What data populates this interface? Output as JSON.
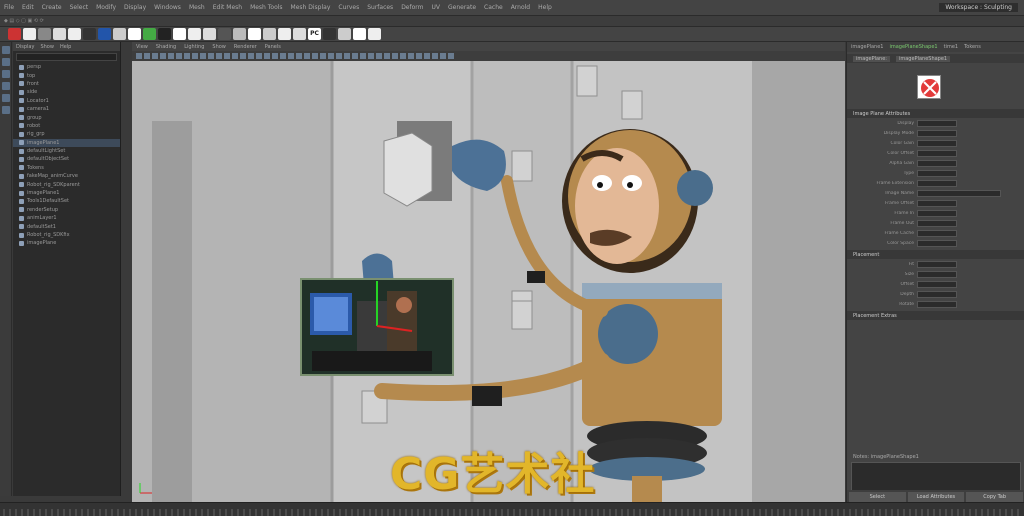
{
  "app": {
    "menu_items": [
      "File",
      "Edit",
      "Create",
      "Select",
      "Modify",
      "Display",
      "Windows",
      "Mesh",
      "Edit Mesh",
      "Mesh Tools",
      "Mesh Display",
      "Curves",
      "Surfaces",
      "Deform",
      "UV",
      "Generate",
      "Cache",
      "Arnold",
      "Help"
    ],
    "workspace_label": "Workspace :",
    "workspace_value": "Sculpting"
  },
  "shelf": {
    "pc_label": "PC"
  },
  "outliner": {
    "menu": [
      "Display",
      "Show",
      "Help"
    ],
    "items": [
      "persp",
      "top",
      "front",
      "side",
      "Locator1",
      "camera1",
      "group",
      "robot",
      "rig_grp",
      "imagePlane1",
      "defaultLightSet",
      "defaultObjectSet",
      "Tokens",
      "fakeMap_animCurve",
      "Robot_rig_SDKparent",
      "imagePlane1",
      "Tools1DefaultSet",
      "renderSetup",
      "animLayer1",
      "defaultSet1",
      "Robot_rig_SDKfix",
      "imagePlane"
    ]
  },
  "viewport": {
    "menu": [
      "View",
      "Shading",
      "Lighting",
      "Show",
      "Renderer",
      "Panels"
    ]
  },
  "attribute_editor": {
    "tabs": [
      "imagePlane1",
      "imagePlaneShape1",
      "time1",
      "Tokens"
    ],
    "active_tab": "imagePlaneShape1",
    "subtabs": [
      "imagePlane:",
      "imagePlaneShape1"
    ],
    "sections": {
      "image_plane_attrs": "Image Plane Attributes",
      "placement": "Placement",
      "placement_extras": "Placement Extras"
    },
    "rows": [
      "Display",
      "Display Mode",
      "Color Gain",
      "Color Offset",
      "Alpha Gain",
      "Type",
      "Frame Extension",
      "Image Name",
      "Frame Offset",
      "Frame In",
      "Frame Out",
      "Frame Cache",
      "Color Space",
      "Fit",
      "Size",
      "Offset",
      "Depth",
      "Rotate"
    ],
    "notes_label": "Notes: imagePlaneShape1",
    "buttons": [
      "Select",
      "Load Attributes",
      "Copy Tab"
    ]
  },
  "watermark": "CG艺术社"
}
